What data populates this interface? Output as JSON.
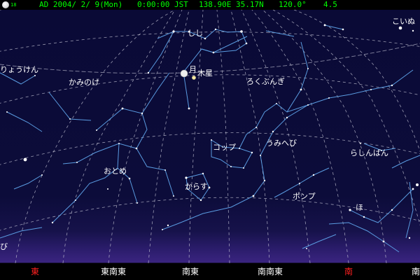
{
  "status": {
    "moon_age": "18",
    "date": "AD 2004/ 2/ 9(Mon)",
    "time": "0:00:00 JST",
    "location": "138.90E 35.17N",
    "fov": "120.0°",
    "mag": "4.5"
  },
  "constellations": [
    {
      "name": "しし"
    },
    {
      "name": "こいぬ"
    },
    {
      "name": "りょうけん"
    },
    {
      "name": "かみのけ"
    },
    {
      "name": "ろくぶんぎ"
    },
    {
      "name": "コップ"
    },
    {
      "name": "うみへび"
    },
    {
      "name": "らしんばん"
    },
    {
      "name": "おとめ"
    },
    {
      "name": "からす"
    },
    {
      "name": "ポンプ"
    },
    {
      "name": "ほ"
    },
    {
      "name": "び"
    }
  ],
  "bodies": [
    {
      "name": "月",
      "icon": "moon-icon"
    },
    {
      "name": "木星",
      "icon": "jupiter-icon"
    }
  ],
  "directions": [
    {
      "label": "東",
      "color": "#ff2020"
    },
    {
      "label": "東南東",
      "color": "#ffffff"
    },
    {
      "label": "南東",
      "color": "#ffffff"
    },
    {
      "label": "南南東",
      "color": "#ffffff"
    },
    {
      "label": "南",
      "color": "#ff2020"
    },
    {
      "label": "南",
      "color": "#ffffff"
    }
  ],
  "colors": {
    "sky": "#0c0c3a",
    "horizon_glow": "#3a2480",
    "grid": "#c8c8d8",
    "constellation_lines": "#5a9be0",
    "status_text": "#00ff00",
    "cardinal_direction": "#ff2020"
  }
}
